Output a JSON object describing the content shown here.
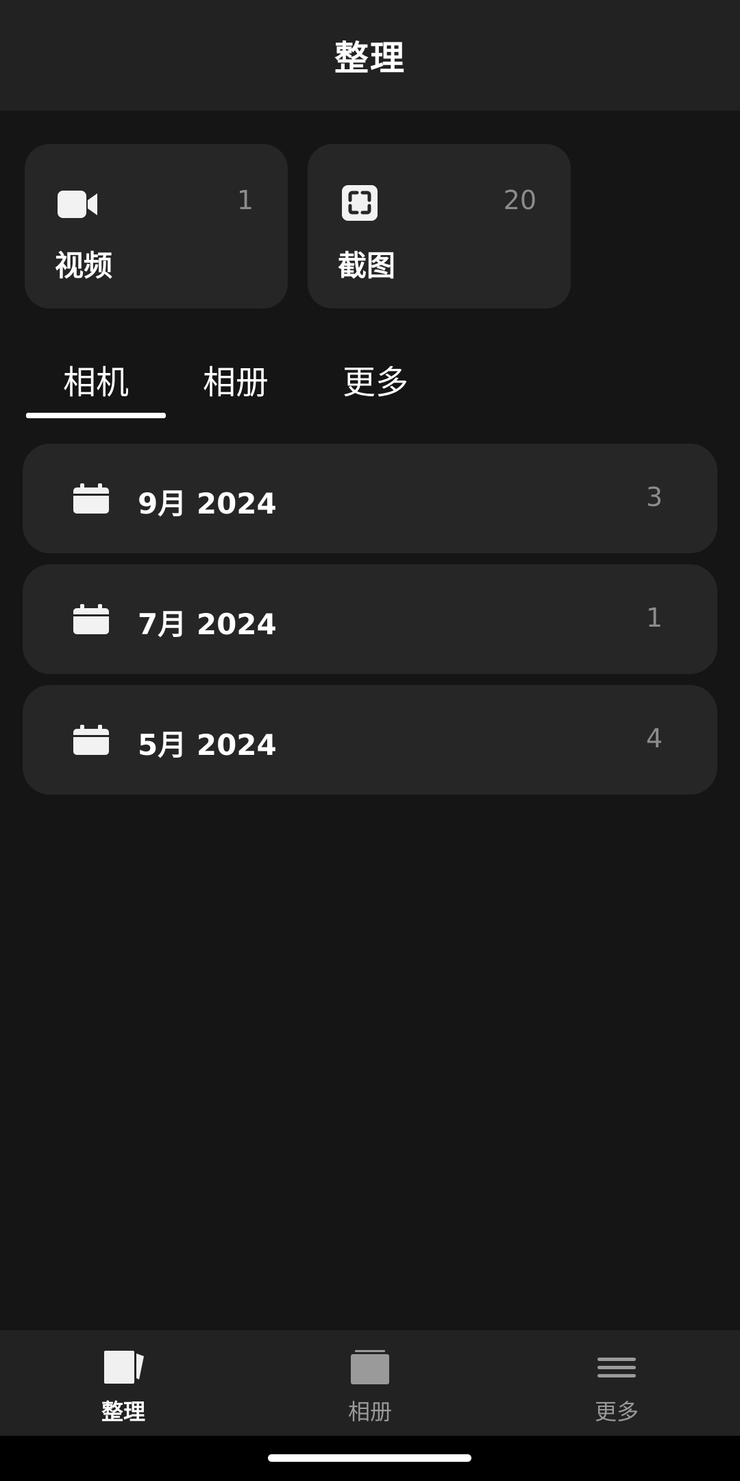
{
  "header": {
    "title": "整理"
  },
  "categories": [
    {
      "icon": "video-camera-icon",
      "count": "1",
      "label": "视频"
    },
    {
      "icon": "screenshot-icon",
      "count": "20",
      "label": "截图"
    }
  ],
  "tabs": {
    "items": [
      {
        "label": "相机"
      },
      {
        "label": "相册"
      },
      {
        "label": "更多"
      }
    ],
    "active": "相机"
  },
  "months": [
    {
      "icon": "calendar-icon",
      "label": "9月 2024",
      "count": "3"
    },
    {
      "icon": "calendar-icon",
      "label": "7月 2024",
      "count": "1"
    },
    {
      "icon": "calendar-icon",
      "label": "5月 2024",
      "count": "4"
    }
  ],
  "bottom_nav": {
    "items": [
      {
        "icon": "organize-icon",
        "label": "整理"
      },
      {
        "icon": "album-icon",
        "label": "相册"
      },
      {
        "icon": "menu-icon",
        "label": "更多"
      }
    ],
    "active": "整理"
  },
  "colors": {
    "background": "#151515",
    "header": "#222222",
    "card": "#262626",
    "text": "#ffffff",
    "muted_text": "#8c8c8c"
  }
}
